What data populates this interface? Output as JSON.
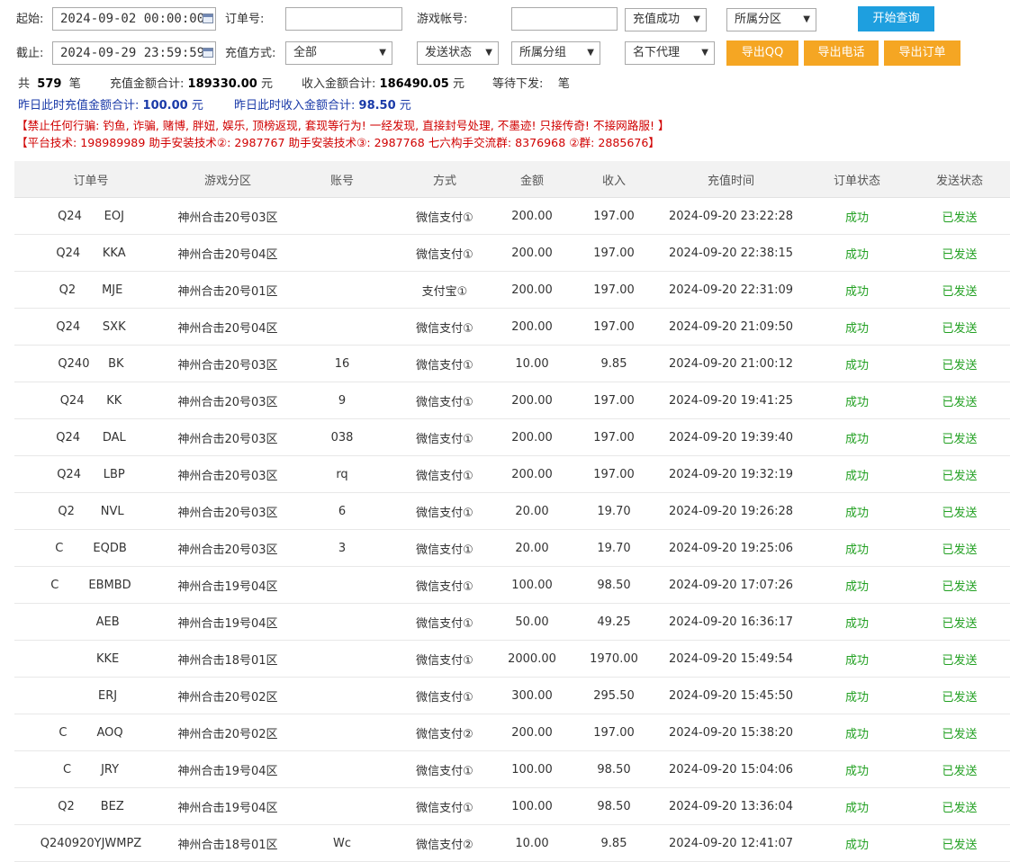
{
  "filters": {
    "start_label": "起始:",
    "start_value": "2024-09-02 00:00:00",
    "end_label": "截止:",
    "end_value": "2024-09-29 23:59:59",
    "order_label": "订单号:",
    "order_value": "",
    "account_label": "游戏帐号:",
    "account_value": "",
    "pay_method_label": "充值方式:",
    "pay_method_value": "全部",
    "recharge_status_value": "充值成功",
    "zone_value": "所属分区",
    "send_status_value": "发送状态",
    "group_value": "所属分组",
    "agent_value": "名下代理"
  },
  "buttons": {
    "search": "开始查询",
    "export_qq": "导出QQ",
    "export_phone": "导出电话",
    "export_order": "导出订单"
  },
  "summary": {
    "count_prefix": "共",
    "count": "579",
    "count_unit": "笔",
    "recharge_label": "充值金额合计:",
    "recharge_total": "189330.00",
    "recharge_unit": "元",
    "income_label": "收入金额合计:",
    "income_total": "186490.05",
    "income_unit": "元",
    "pending_label": "等待下发:",
    "pending_unit": "笔",
    "yesterday_recharge_label": "昨日此时充值金额合计:",
    "yesterday_recharge": "100.00",
    "yesterday_recharge_unit": "元",
    "yesterday_income_label": "昨日此时收入金额合计:",
    "yesterday_income": "98.50",
    "yesterday_income_unit": "元"
  },
  "notices": {
    "line1": "【禁止任何行骗: 钓鱼, 诈骗, 赌博, 胖妞, 娱乐, 顶榜返现, 套现等行为! 一经发现, 直接封号处理, 不墨迹! 只接传奇! 不接网路服! 】",
    "line2": "【平台技术: 198989989 助手安装技术②: 2987767 助手安装技术③: 2987768 七六构手交流群: 8376968 ②群: 2885676】"
  },
  "table": {
    "headers": [
      "订单号",
      "游戏分区",
      "账号",
      "方式",
      "金额",
      "收入",
      "充值时间",
      "订单状态",
      "发送状态"
    ],
    "rows": [
      [
        "Q24      EOJ",
        "神州合击20号03区",
        "",
        "微信支付①",
        "200.00",
        "197.00",
        "2024-09-20 23:22:28",
        "成功",
        "已发送"
      ],
      [
        "Q24      KKA",
        "神州合击20号04区",
        "",
        "微信支付①",
        "200.00",
        "197.00",
        "2024-09-20 22:38:15",
        "成功",
        "已发送"
      ],
      [
        "Q2       MJE",
        "神州合击20号01区",
        "",
        "支付宝①",
        "200.00",
        "197.00",
        "2024-09-20 22:31:09",
        "成功",
        "已发送"
      ],
      [
        "Q24      SXK",
        "神州合击20号04区",
        "",
        "微信支付①",
        "200.00",
        "197.00",
        "2024-09-20 21:09:50",
        "成功",
        "已发送"
      ],
      [
        "Q240     BK",
        "神州合击20号03区",
        "16",
        "微信支付①",
        "10.00",
        "9.85",
        "2024-09-20 21:00:12",
        "成功",
        "已发送"
      ],
      [
        "Q24      KK",
        "神州合击20号03区",
        "9",
        "微信支付①",
        "200.00",
        "197.00",
        "2024-09-20 19:41:25",
        "成功",
        "已发送"
      ],
      [
        "Q24      DAL",
        "神州合击20号03区",
        "038",
        "微信支付①",
        "200.00",
        "197.00",
        "2024-09-20 19:39:40",
        "成功",
        "已发送"
      ],
      [
        "Q24      LBP",
        "神州合击20号03区",
        "rq",
        "微信支付①",
        "200.00",
        "197.00",
        "2024-09-20 19:32:19",
        "成功",
        "已发送"
      ],
      [
        "Q2       NVL",
        "神州合击20号03区",
        "6",
        "微信支付①",
        "20.00",
        "19.70",
        "2024-09-20 19:26:28",
        "成功",
        "已发送"
      ],
      [
        "C        EQDB",
        "神州合击20号03区",
        "3",
        "微信支付①",
        "20.00",
        "19.70",
        "2024-09-20 19:25:06",
        "成功",
        "已发送"
      ],
      [
        "C        EBMBD",
        "神州合击19号04区",
        "",
        "微信支付①",
        "100.00",
        "98.50",
        "2024-09-20 17:07:26",
        "成功",
        "已发送"
      ],
      [
        "         AEB",
        "神州合击19号04区",
        "",
        "微信支付①",
        "50.00",
        "49.25",
        "2024-09-20 16:36:17",
        "成功",
        "已发送"
      ],
      [
        "         KKE",
        "神州合击18号01区",
        "",
        "微信支付①",
        "2000.00",
        "1970.00",
        "2024-09-20 15:49:54",
        "成功",
        "已发送"
      ],
      [
        "         ERJ",
        "神州合击20号02区",
        "",
        "微信支付①",
        "300.00",
        "295.50",
        "2024-09-20 15:45:50",
        "成功",
        "已发送"
      ],
      [
        "C        AOQ",
        "神州合击20号02区",
        "",
        "微信支付②",
        "200.00",
        "197.00",
        "2024-09-20 15:38:20",
        "成功",
        "已发送"
      ],
      [
        "C        JRY",
        "神州合击19号04区",
        "",
        "微信支付①",
        "100.00",
        "98.50",
        "2024-09-20 15:04:06",
        "成功",
        "已发送"
      ],
      [
        "Q2       BEZ",
        "神州合击19号04区",
        "",
        "微信支付①",
        "100.00",
        "98.50",
        "2024-09-20 13:36:04",
        "成功",
        "已发送"
      ],
      [
        "Q240920YJWMPZ",
        "神州合击18号01区",
        "Wc",
        "微信支付②",
        "10.00",
        "9.85",
        "2024-09-20 12:41:07",
        "成功",
        "已发送"
      ]
    ]
  },
  "colors": {
    "search_button": "#1e9fdf",
    "export_button": "#f5a623",
    "success_text": "#22a022",
    "warning_text": "#d00000",
    "yesterday_text": "#1a3aa8"
  }
}
